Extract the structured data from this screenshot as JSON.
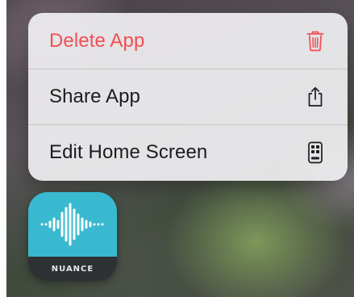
{
  "context_menu": {
    "items": [
      {
        "label": "Delete App",
        "icon": "trash-icon",
        "style": "destructive",
        "color": "#f04e54"
      },
      {
        "label": "Share App",
        "icon": "share-icon",
        "style": "default",
        "color": "#1c1c1e"
      },
      {
        "label": "Edit Home Screen",
        "icon": "phone-screen-icon",
        "style": "default",
        "color": "#1c1c1e"
      }
    ]
  },
  "app_icon": {
    "brand": "NUANCE",
    "glyph": "waveform-icon",
    "colors": {
      "top": "#39b9cf",
      "bottom": "#2e3134"
    }
  }
}
